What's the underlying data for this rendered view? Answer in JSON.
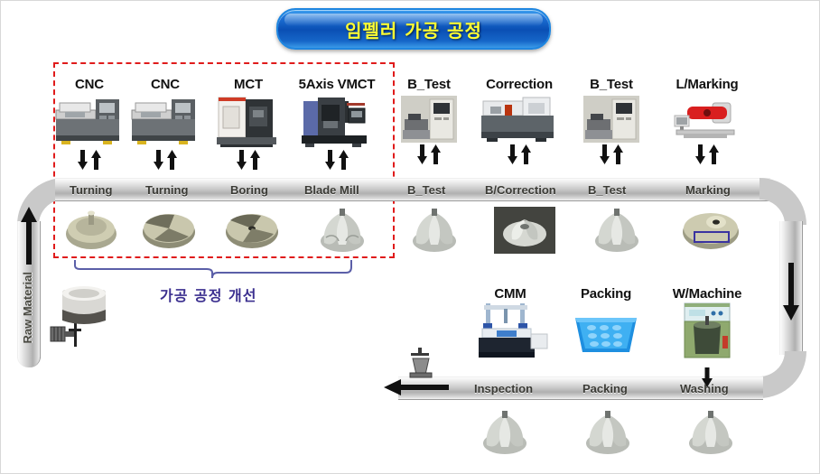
{
  "title": {
    "text": "임펠러 가공 공정"
  },
  "improvement": {
    "caption": "가공 공정 개선",
    "box_label": "machining-improvement-scope"
  },
  "raw_material": {
    "label": "Raw Material"
  },
  "top_stations": [
    {
      "machine": "CNC",
      "process": "Turning",
      "part": "turned-billet"
    },
    {
      "machine": "CNC",
      "process": "Turning",
      "part": "turned-disc"
    },
    {
      "machine": "MCT",
      "process": "Boring",
      "part": "bored-disc"
    },
    {
      "machine": "5Axis VMCT",
      "process": "Blade  Mill",
      "part": "bladed-impeller"
    },
    {
      "machine": "B_Test",
      "process": "B_Test",
      "part": "impeller-balance"
    },
    {
      "machine": "Correction",
      "process": "B/Correction",
      "part": "impeller-corrected"
    },
    {
      "machine": "B_Test",
      "process": "B_Test",
      "part": "impeller-retest"
    },
    {
      "machine": "L/Marking",
      "process": "Marking",
      "part": "impeller-marked"
    }
  ],
  "bottom_stations": [
    {
      "machine": "CMM",
      "process": "Inspection",
      "part": "impeller-inspected"
    },
    {
      "machine": "Packing",
      "process": "Packing",
      "part": "impeller-packed"
    },
    {
      "machine": "W/Machine",
      "process": "Washing",
      "part": "impeller-washed"
    }
  ],
  "colors": {
    "title_bg": "#0a4fb4",
    "title_text": "#ffff33",
    "dashed_box": "#e01b1b",
    "improve_text": "#3b2f8f",
    "rail": "#c9c9c9"
  }
}
